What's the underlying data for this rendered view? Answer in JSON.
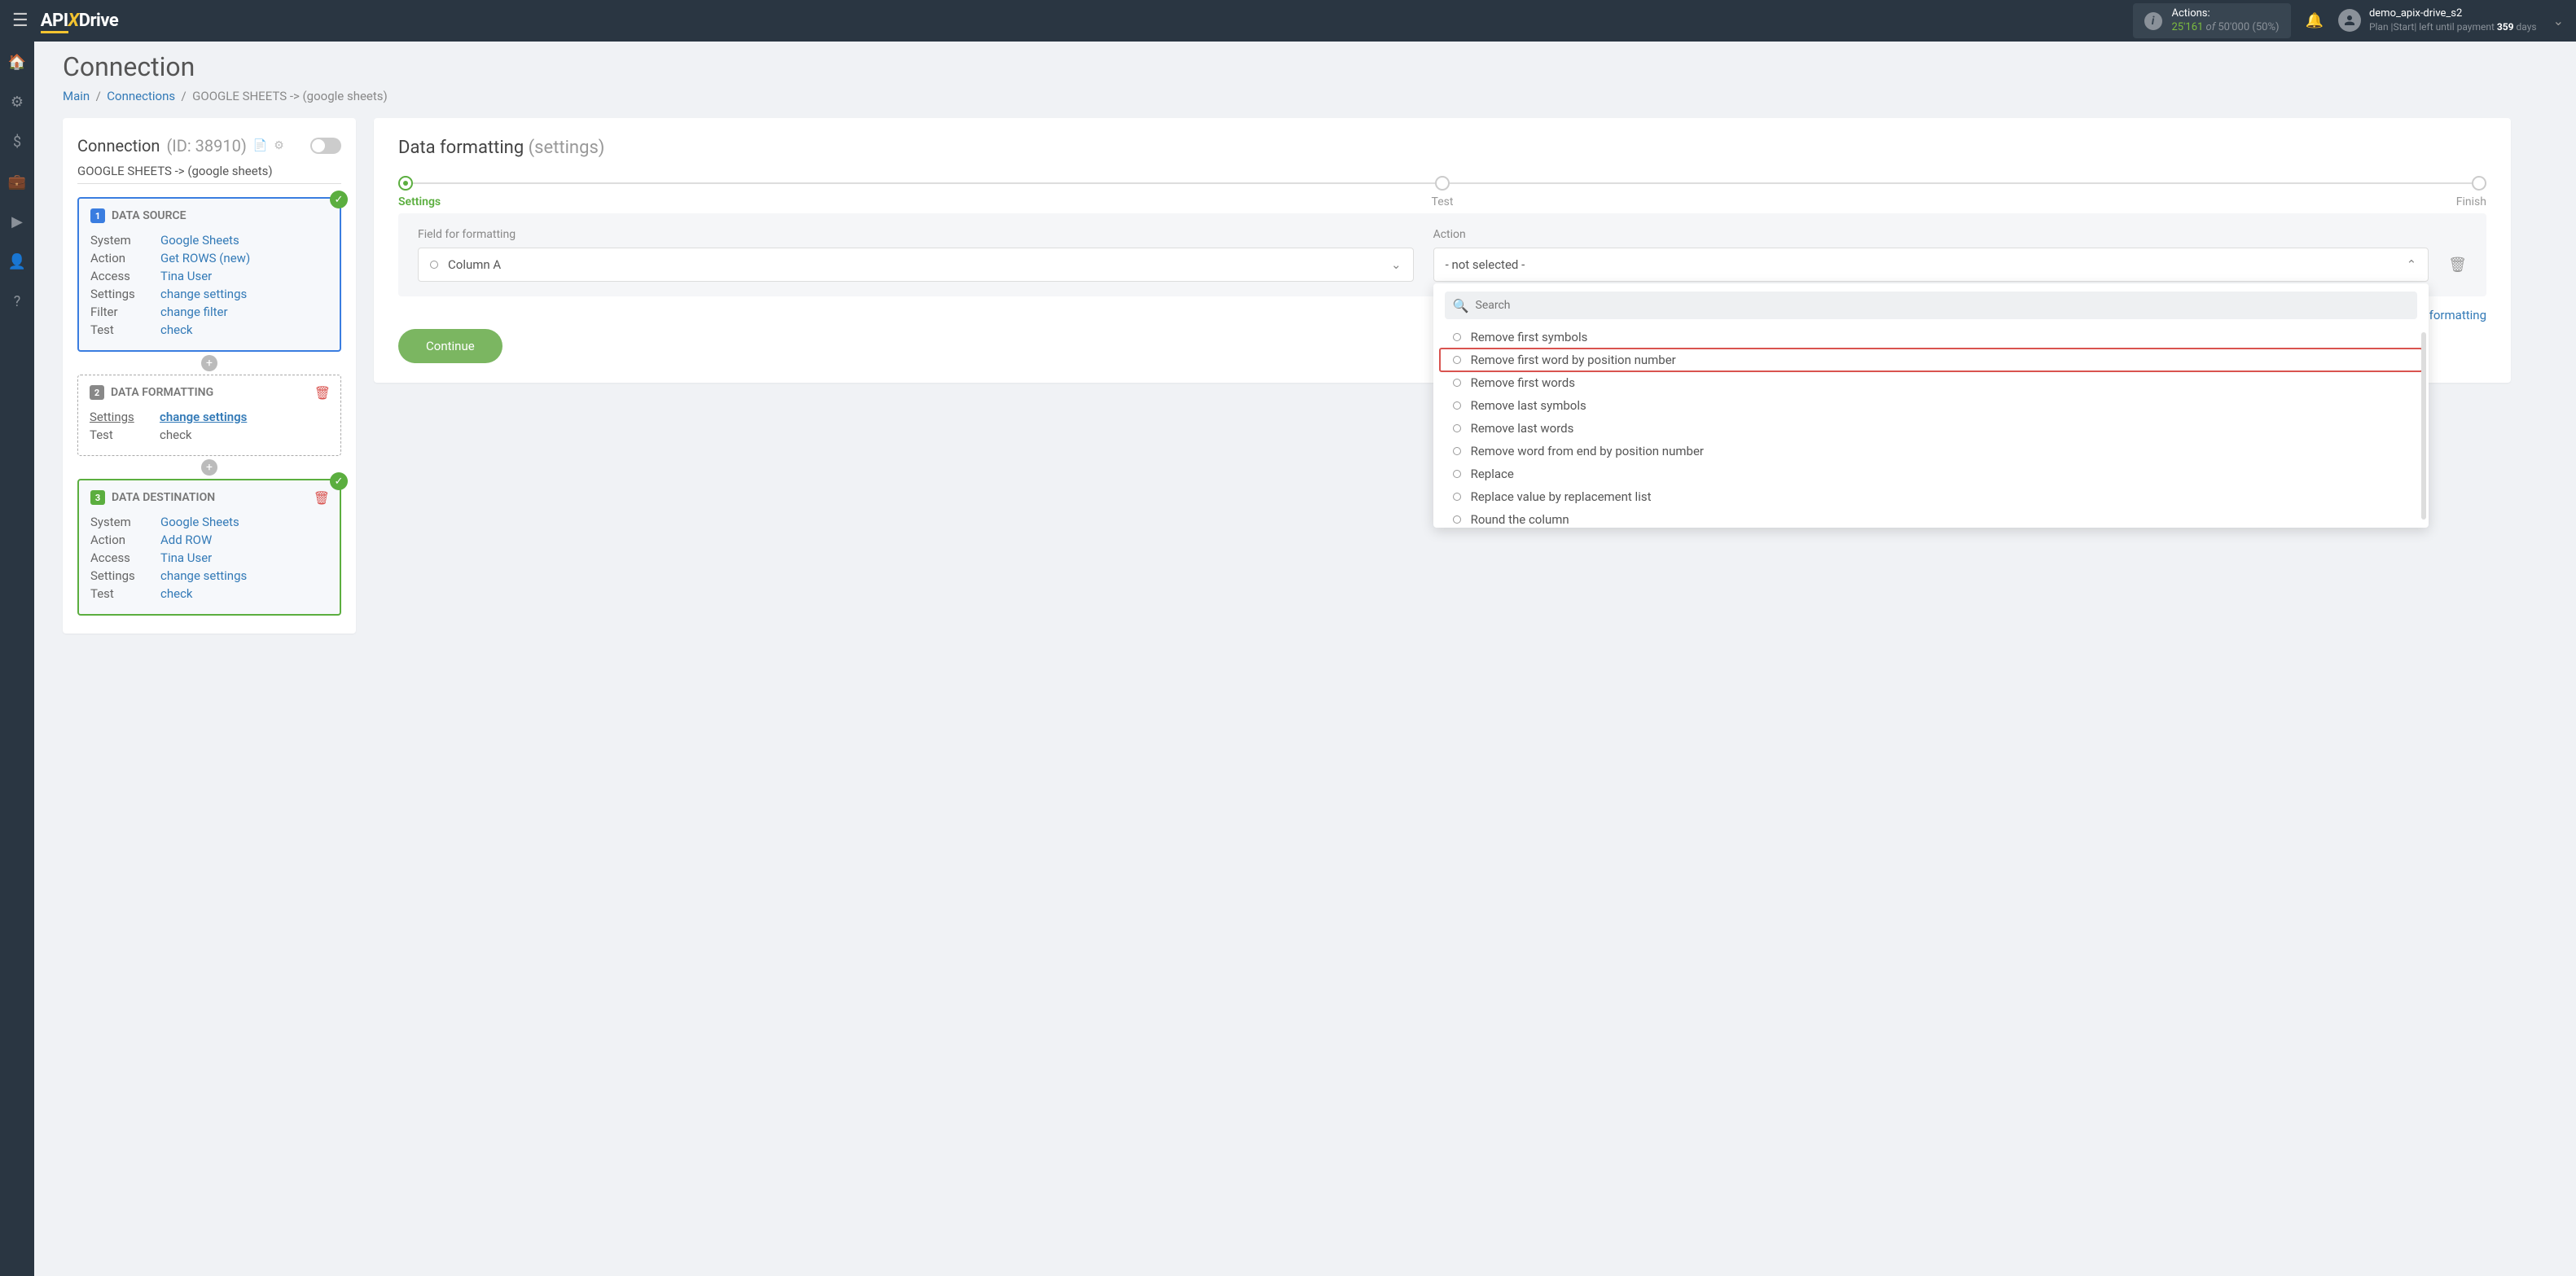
{
  "header": {
    "actions_label": "Actions:",
    "actions_count": "25'161",
    "actions_of": "of",
    "actions_total": "50'000",
    "actions_pct": "(50%)",
    "username": "demo_apix-drive_s2",
    "plan_prefix": "Plan |Start| left until payment ",
    "plan_days": "359",
    "plan_suffix": " days"
  },
  "page": {
    "title": "Connection"
  },
  "breadcrumb": {
    "main": "Main",
    "connections": "Connections",
    "current": "GOOGLE SHEETS -> (google sheets)"
  },
  "panel": {
    "title": "Connection ",
    "id": "(ID: 38910)",
    "conn_name": "GOOGLE SHEETS -> (google sheets)"
  },
  "source": {
    "heading": "DATA SOURCE",
    "system_l": "System",
    "system_v": "Google Sheets",
    "action_l": "Action",
    "action_v": "Get ROWS (new)",
    "access_l": "Access",
    "access_v": "Tina User",
    "settings_l": "Settings",
    "settings_v": "change settings",
    "filter_l": "Filter",
    "filter_v": "change filter",
    "test_l": "Test",
    "test_v": "check"
  },
  "formatting": {
    "heading": "DATA FORMATTING",
    "settings_l": "Settings",
    "settings_v": "change settings",
    "test_l": "Test",
    "test_v": "check"
  },
  "destination": {
    "heading": "DATA DESTINATION",
    "system_l": "System",
    "system_v": "Google Sheets",
    "action_l": "Action",
    "action_v": "Add ROW",
    "access_l": "Access",
    "access_v": "Tina User",
    "settings_l": "Settings",
    "settings_v": "change settings",
    "test_l": "Test",
    "test_v": "check"
  },
  "right": {
    "title": "Data formatting ",
    "subtitle": "(settings)",
    "step1": "Settings",
    "step2": "Test",
    "step3": "Finish",
    "field_label": "Field for formatting",
    "field_value": "Column A",
    "action_label": "Action",
    "action_value": "- not selected -",
    "add_link": "+ Add field for formatting",
    "continue": "Continue",
    "search_placeholder": "Search",
    "options": [
      "Remove first symbols",
      "Remove first word by position number",
      "Remove first words",
      "Remove last symbols",
      "Remove last words",
      "Remove word from end by position number",
      "Replace",
      "Replace value by replacement list",
      "Round the column"
    ]
  }
}
